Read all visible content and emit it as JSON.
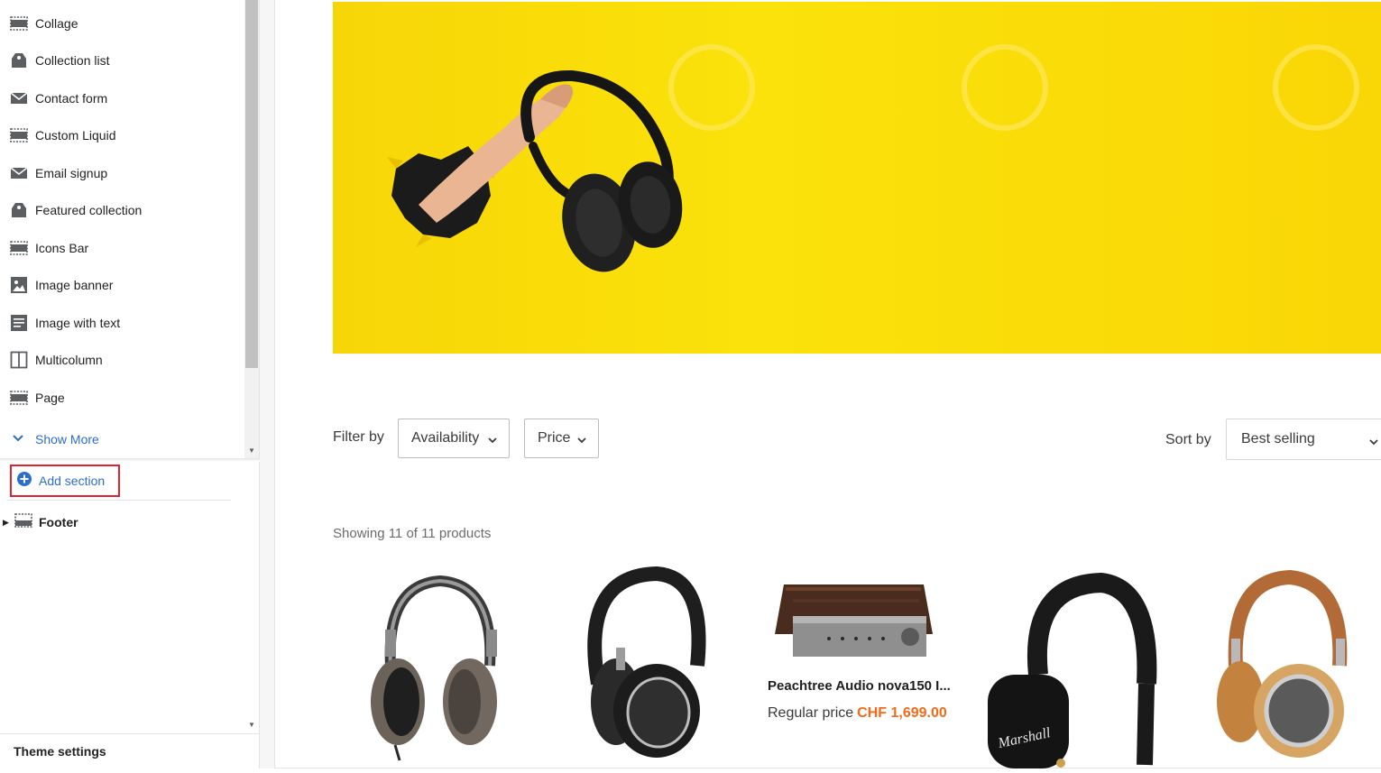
{
  "sidebar": {
    "sections": [
      {
        "label": "Collage",
        "icon": "layout-icon"
      },
      {
        "label": "Collection list",
        "icon": "tag-icon"
      },
      {
        "label": "Contact form",
        "icon": "envelope-icon"
      },
      {
        "label": "Custom Liquid",
        "icon": "layout-icon"
      },
      {
        "label": "Email signup",
        "icon": "envelope-icon"
      },
      {
        "label": "Featured collection",
        "icon": "tag-icon"
      },
      {
        "label": "Icons Bar",
        "icon": "layout-icon"
      },
      {
        "label": "Image banner",
        "icon": "image-icon"
      },
      {
        "label": "Image with text",
        "icon": "text-block-icon"
      },
      {
        "label": "Multicolumn",
        "icon": "columns-icon"
      },
      {
        "label": "Page",
        "icon": "layout-icon"
      }
    ],
    "show_more": "Show More",
    "add_section": "Add section",
    "footer": "Footer",
    "theme_settings": "Theme settings"
  },
  "preview": {
    "filter_label": "Filter by",
    "filters": [
      "Availability",
      "Price"
    ],
    "sort_label": "Sort by",
    "sort_value": "Best selling",
    "showing": "Showing 11 of 11 products",
    "product": {
      "title": "Peachtree Audio nova150 I...",
      "price_label": "Regular price",
      "price": "CHF 1,699.00"
    }
  },
  "colors": {
    "accent": "#2c6ecb",
    "highlight_border": "#e0232e",
    "banner": "#fbe20a",
    "sale_price": "#f26a1b"
  }
}
